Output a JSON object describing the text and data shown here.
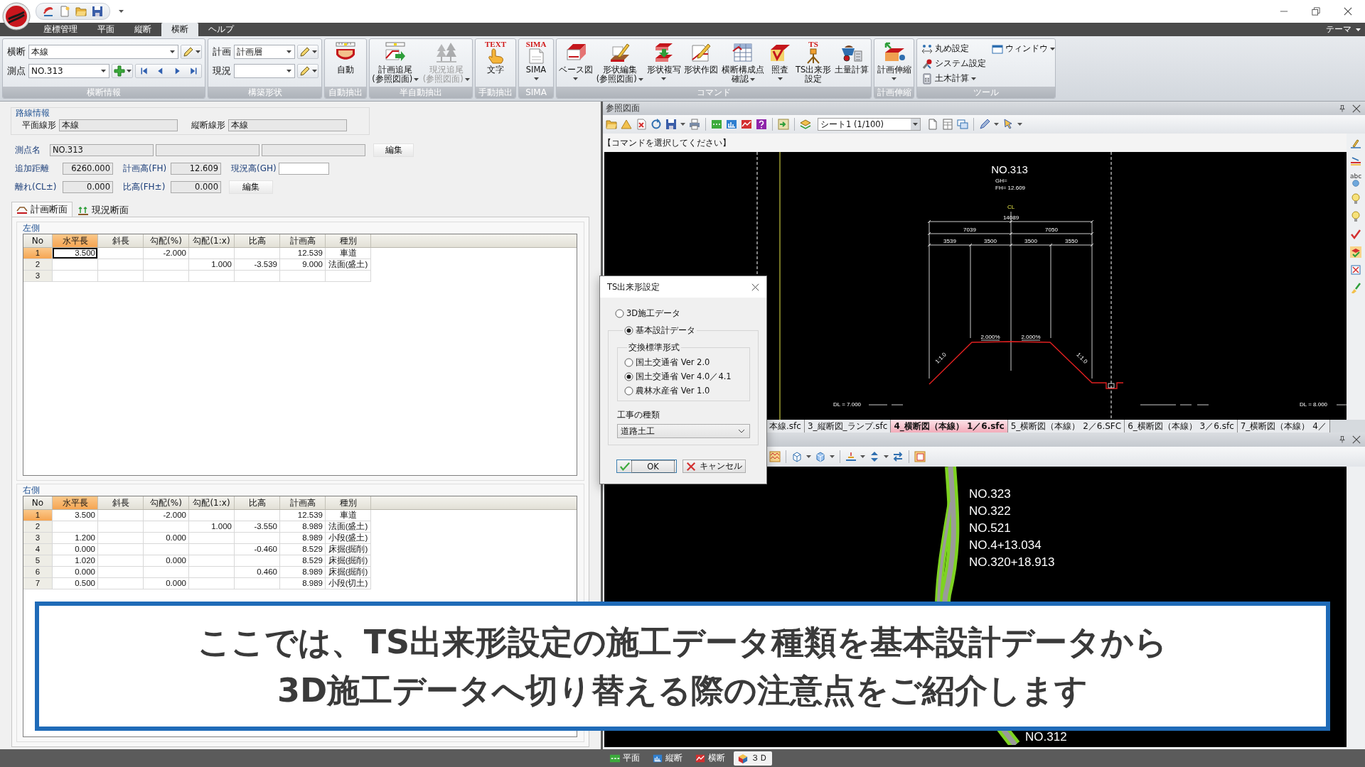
{
  "menu_tabs": [
    {
      "label": "座標管理",
      "selected": false
    },
    {
      "label": "平面",
      "selected": false
    },
    {
      "label": "縦断",
      "selected": false
    },
    {
      "label": "横断",
      "selected": true
    },
    {
      "label": "ヘルプ",
      "selected": false
    }
  ],
  "theme_menu": "テーマ",
  "ribbon": {
    "groups": [
      {
        "label": "横断情報",
        "kind": "fields",
        "rows": [
          {
            "label": "横断",
            "value": "本線",
            "kind": "edit"
          },
          {
            "label": "測点",
            "value": "NO.313",
            "kind": "navigate"
          }
        ]
      },
      {
        "label": "構築形状",
        "kind": "fields",
        "rows": [
          {
            "label": "計画",
            "value": "計画層",
            "kind": "edit"
          },
          {
            "label": "現況",
            "kind": "edit"
          }
        ]
      },
      {
        "label": "自動抽出",
        "kind": "large",
        "buttons": [
          {
            "lines": [
              "自動"
            ],
            "dropdown": false,
            "disabled": false
          }
        ]
      },
      {
        "label": "半自動抽出",
        "kind": "large",
        "buttons": [
          {
            "lines": [
              "計画追尾",
              "(参照図面)"
            ],
            "dropdown": true,
            "disabled": false
          },
          {
            "lines": [
              "現況追尾",
              "(参照図面)"
            ],
            "dropdown": true,
            "disabled": true
          }
        ]
      },
      {
        "label": "手動抽出",
        "kind": "large",
        "buttons": [
          {
            "lines": [
              "文字"
            ],
            "icon_text": "TEXT",
            "dropdown": false,
            "disabled": false
          }
        ]
      },
      {
        "label": "SIMA",
        "kind": "large",
        "buttons": [
          {
            "lines": [
              "SIMA"
            ],
            "icon_text": "SIMA",
            "dropdown": true,
            "disabled": false
          }
        ]
      },
      {
        "label": "コマンド",
        "kind": "large",
        "buttons": [
          {
            "lines": [
              "ベース図"
            ],
            "dropdown": true,
            "disabled": false
          },
          {
            "lines": [
              "形状編集",
              "(参照図面)"
            ],
            "dropdown": true,
            "disabled": false
          },
          {
            "lines": [
              "形状複写"
            ],
            "dropdown": true,
            "disabled": false
          },
          {
            "lines": [
              "形状作図"
            ],
            "dropdown": false,
            "disabled": false
          },
          {
            "lines": [
              "横断構成点",
              "確認"
            ],
            "dropdown": true,
            "disabled": false
          },
          {
            "lines": [
              "照査"
            ],
            "dropdown": true,
            "disabled": false
          },
          {
            "lines": [
              "TS出来形",
              "設定"
            ],
            "icon_text": "TS",
            "dropdown": false,
            "disabled": false
          },
          {
            "lines": [
              "土量計算"
            ],
            "dropdown": false,
            "disabled": false
          }
        ]
      },
      {
        "label": "計画伸縮",
        "kind": "large",
        "buttons": [
          {
            "lines": [
              "計画伸縮"
            ],
            "dropdown": true,
            "disabled": false
          }
        ]
      },
      {
        "label": "ツール",
        "kind": "small",
        "buttons": [
          {
            "label": "丸め設定",
            "dropdown": false
          },
          {
            "label": "ウィンドウ",
            "dropdown": true
          },
          {
            "label": "システム設定",
            "dropdown": false
          },
          {
            "label": "土木計算",
            "dropdown": true
          }
        ]
      }
    ]
  },
  "route_info": {
    "title": "路線情報",
    "fields": [
      {
        "label": "平面線形",
        "value": "本線"
      },
      {
        "label": "縦断線形",
        "value": "本線"
      }
    ]
  },
  "station": {
    "label": "測点名",
    "values": [
      "NO.313"
    ],
    "button": "編集"
  },
  "measure_rows": [
    {
      "fields": [
        {
          "label": "追加距離",
          "value": "6260.000",
          "readonly": true
        },
        {
          "label": "計画高(FH)",
          "value": "12.609",
          "readonly": true
        },
        {
          "label": "現況高(GH)",
          "readonly": false
        }
      ]
    },
    {
      "fields": [
        {
          "label": "離れ(CL±)",
          "value": "0.000",
          "readonly": true
        },
        {
          "label": "比高(FH±)",
          "value": "0.000",
          "readonly": true
        }
      ],
      "button": "編集"
    }
  ],
  "section_tabs": [
    {
      "label": "計画断面",
      "selected": true
    },
    {
      "label": "現況断面",
      "selected": false
    }
  ],
  "sections": [
    {
      "title": "左側",
      "focused": true,
      "columns": [
        {
          "label": "No",
          "selected": false
        },
        {
          "label": "水平長",
          "selected": true
        },
        {
          "label": "斜長",
          "selected": false
        },
        {
          "label": "勾配(%)",
          "selected": false
        },
        {
          "label": "勾配(1:x)",
          "selected": false
        },
        {
          "label": "比高",
          "selected": false
        },
        {
          "label": "計画高",
          "selected": false
        },
        {
          "label": "種別",
          "selected": false
        }
      ],
      "rows": [
        {
          "selected": true,
          "cells": [
            "1",
            "3.500",
            null,
            "-2.000",
            null,
            null,
            "12.539",
            "車道"
          ]
        },
        {
          "selected": false,
          "cells": [
            "2",
            null,
            null,
            null,
            "1.000",
            "-3.539",
            "9.000",
            "法面(盛土)"
          ]
        },
        {
          "selected": false,
          "cells": [
            "3",
            null,
            null,
            null,
            null,
            null,
            null,
            null
          ]
        }
      ]
    },
    {
      "title": "右側",
      "focused": false,
      "columns": [
        {
          "label": "No",
          "selected": false
        },
        {
          "label": "水平長",
          "selected": true
        },
        {
          "label": "斜長",
          "selected": false
        },
        {
          "label": "勾配(%)",
          "selected": false
        },
        {
          "label": "勾配(1:x)",
          "selected": false
        },
        {
          "label": "比高",
          "selected": false
        },
        {
          "label": "計画高",
          "selected": false
        },
        {
          "label": "種別",
          "selected": false
        }
      ],
      "rows": [
        {
          "selected": true,
          "cells": [
            "1",
            "3.500",
            null,
            "-2.000",
            null,
            null,
            "12.539",
            "車道"
          ]
        },
        {
          "selected": false,
          "cells": [
            "2",
            null,
            null,
            null,
            "1.000",
            "-3.550",
            "8.989",
            "法面(盛土)"
          ]
        },
        {
          "selected": false,
          "cells": [
            "3",
            "1.200",
            null,
            "0.000",
            null,
            null,
            "8.989",
            "小段(盛土)"
          ]
        },
        {
          "selected": false,
          "cells": [
            "4",
            "0.000",
            null,
            null,
            null,
            "-0.460",
            "8.529",
            "床掘(掘削)"
          ]
        },
        {
          "selected": false,
          "cells": [
            "5",
            "1.020",
            null,
            "0.000",
            null,
            null,
            "8.529",
            "床掘(掘削)"
          ]
        },
        {
          "selected": false,
          "cells": [
            "6",
            "0.000",
            null,
            null,
            null,
            "0.460",
            "8.989",
            "床掘(掘削)"
          ]
        },
        {
          "selected": false,
          "cells": [
            "7",
            "0.500",
            null,
            "0.000",
            null,
            null,
            "8.989",
            "小段(切土)"
          ]
        }
      ]
    }
  ],
  "reference_view": {
    "title": "参照図面",
    "sheet": "シート1 (1/100)",
    "prompt": "【コマンドを選択してください】",
    "side_icon_text": "abc",
    "drawing_labels": [
      "NO.313",
      "GH=",
      "FH= 12.609",
      "CL",
      "14089",
      "7039",
      "7050",
      "3539",
      "3500",
      "3500",
      "3550",
      "2.000%",
      "2.000%",
      "1:1.0",
      "1:1.0",
      "DL = 7.000",
      "DL = 8.000"
    ],
    "sheet_tabs": [
      {
        "label": "本線.sfc",
        "selected": false
      },
      {
        "label": "3_縦断図_ランプ.sfc",
        "selected": false
      },
      {
        "label": "4_横断図（本線） 1／6.sfc",
        "selected": true
      },
      {
        "label": "5_横断図（本線） 2／6.SFC",
        "selected": false
      },
      {
        "label": "6_横断図（本線） 3／6.sfc",
        "selected": false
      },
      {
        "label": "7_横断図（本線） 4／",
        "selected": false
      }
    ]
  },
  "plan_view": {
    "labels": [
      "NO.323",
      "NO.322",
      "NO.521",
      "NO.4+13.034",
      "NO.320+18.913",
      "NO.312"
    ]
  },
  "view_tabs": [
    {
      "label": "平面",
      "selected": false
    },
    {
      "label": "縦断",
      "selected": false
    },
    {
      "label": "横断",
      "selected": false
    },
    {
      "label": "３Ｄ",
      "selected": true
    }
  ],
  "dialog": {
    "title": "TS出来形設定",
    "data_types": [
      {
        "label": "3D施工データ",
        "selected": false
      },
      {
        "label": "基本設計データ",
        "selected": true
      }
    ],
    "format_title": "交換標準形式",
    "formats": [
      {
        "label": "国土交通省 Ver 2.0",
        "selected": false
      },
      {
        "label": "国土交通省 Ver 4.0／4.1",
        "selected": true
      },
      {
        "label": "農林水産省 Ver 1.0",
        "selected": false
      }
    ],
    "work_type_label": "工事の種類",
    "work_type": "道路土工",
    "buttons": [
      {
        "label": "OK",
        "kind": "ok"
      },
      {
        "label": "キャンセル",
        "kind": "cancel"
      }
    ]
  },
  "subtitle": {
    "lines": [
      "ここでは、TS出来形設定の施工データ種類を基本設計データから",
      "3D施工データへ切り替える際の注意点をご紹介します"
    ]
  }
}
